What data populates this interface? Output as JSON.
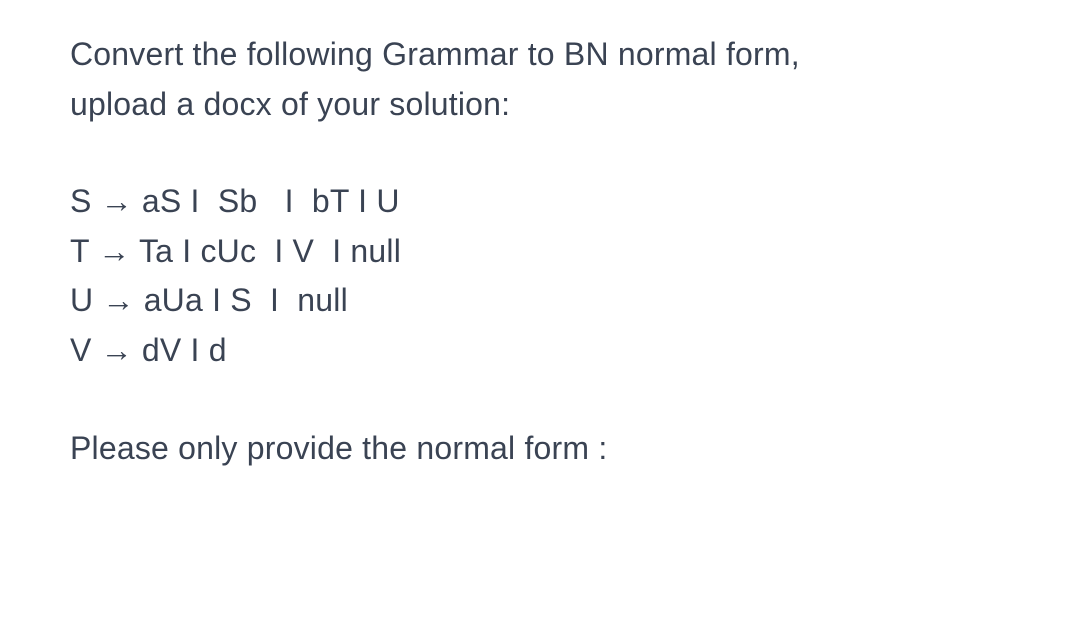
{
  "intro": {
    "line1": "Convert the following Grammar to BN normal form,",
    "line2": "upload a docx of your solution:"
  },
  "grammar": {
    "rule1": "S → aS I  Sb   I  bT I U",
    "rule2": "T → Ta I cUc  I V  I null",
    "rule3": "U → aUa I S  I  null",
    "rule4": "V → dV I d"
  },
  "footer": {
    "text": "Please only provide the normal form :"
  }
}
